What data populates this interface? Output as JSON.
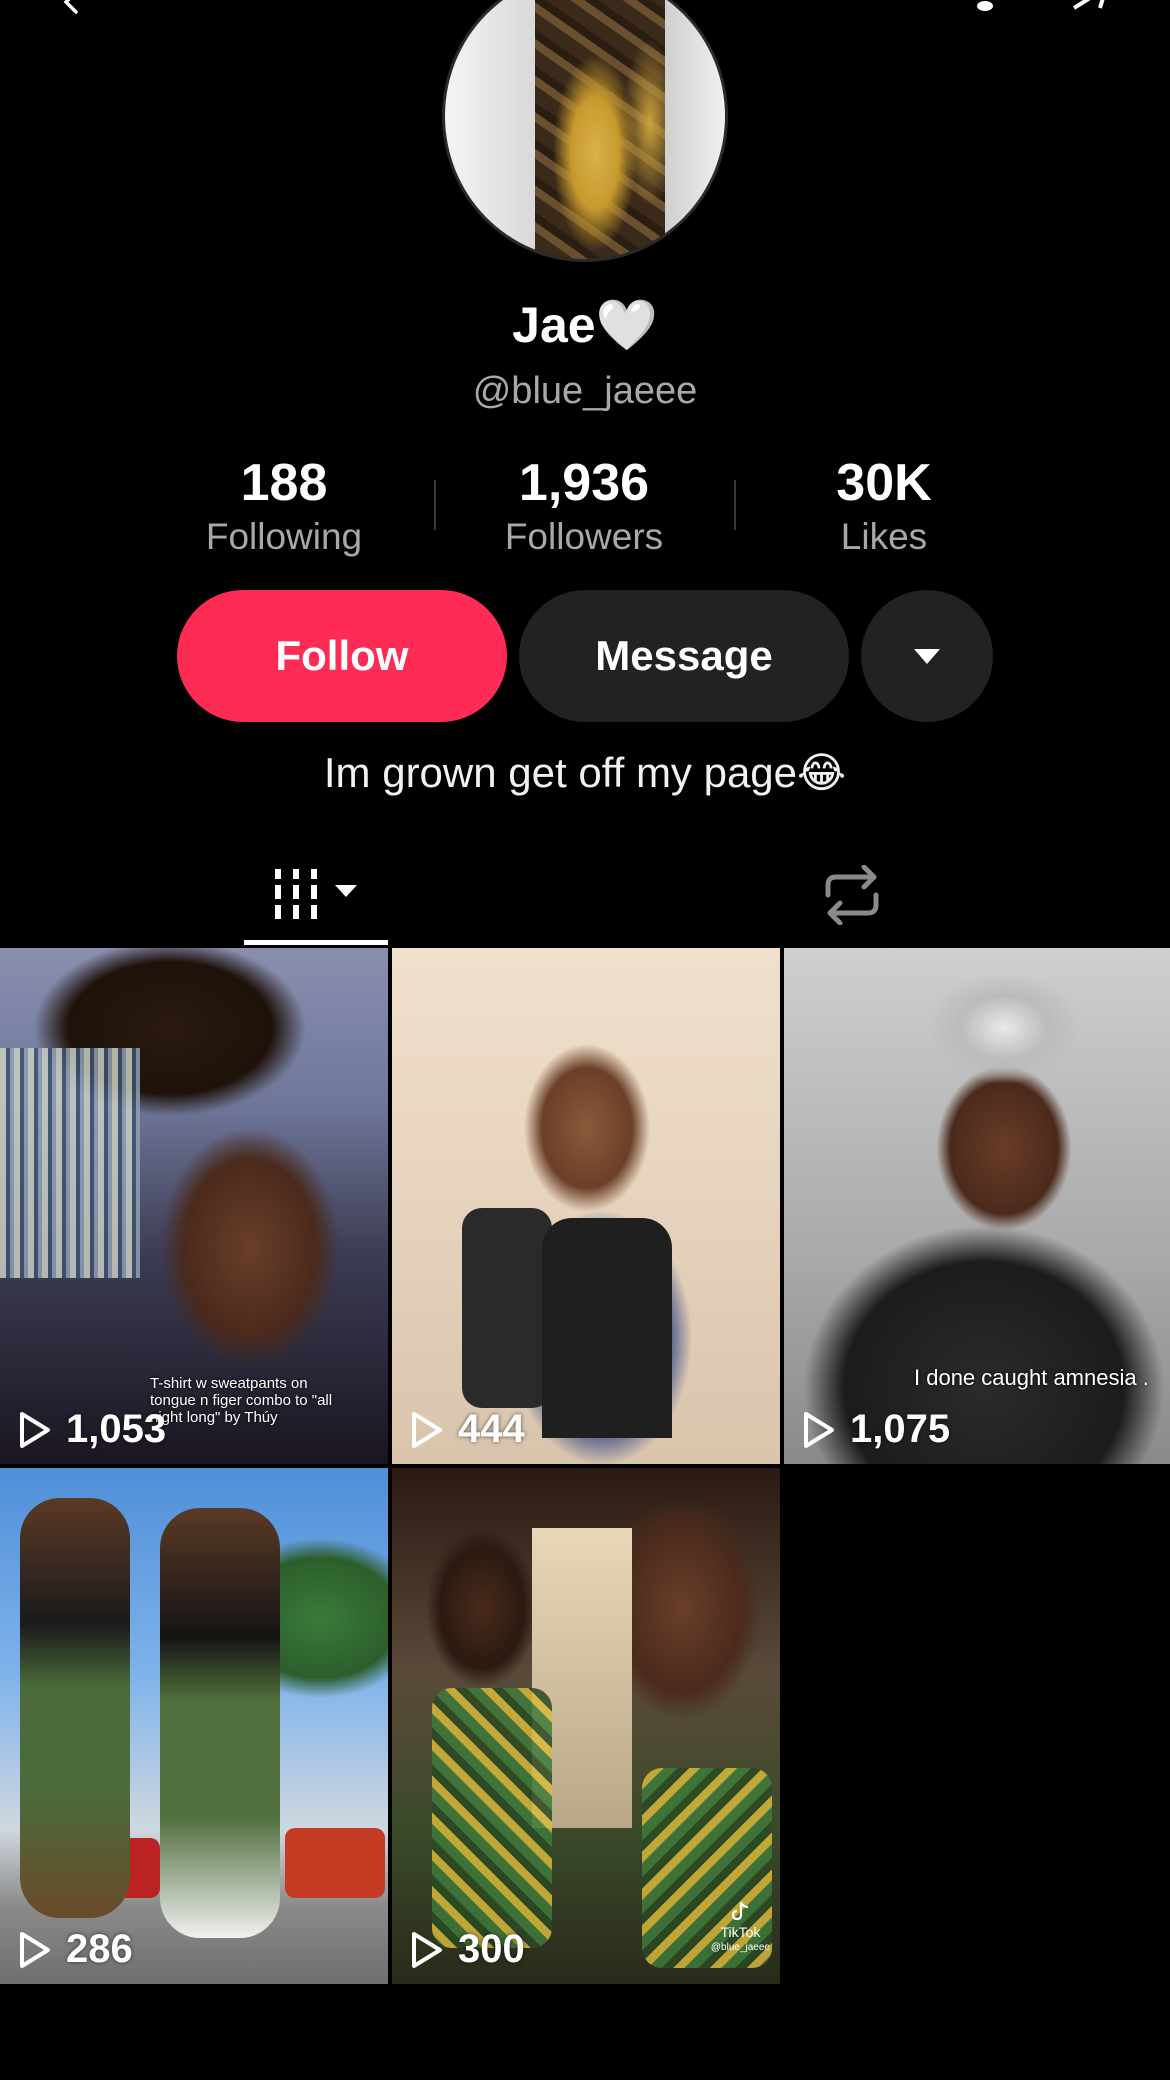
{
  "profile": {
    "name": "Jae🤍",
    "handle": "@blue_jaeee",
    "bio": "Im grown get off my page😂"
  },
  "stats": {
    "following_count": "188",
    "following_label": "Following",
    "followers_count": "1,936",
    "followers_label": "Followers",
    "likes_count": "30K",
    "likes_label": "Likes"
  },
  "actions": {
    "follow_label": "Follow",
    "message_label": "Message"
  },
  "colors": {
    "accent": "#fe2c55",
    "background": "#000000",
    "button_dark": "#222222",
    "secondary_text": "#a8a8a8"
  },
  "tabs": [
    {
      "icon": "videos-grid-icon",
      "active": true
    },
    {
      "icon": "repost-icon",
      "active": false
    }
  ],
  "videos": [
    {
      "views": "1,053",
      "caption": "T-shirt w sweatpants on tongue n figer combo to \"all night long\" by Thúy"
    },
    {
      "views": "444"
    },
    {
      "views": "1,075",
      "caption": "I done caught amnesia ."
    },
    {
      "views": "286"
    },
    {
      "views": "300",
      "watermark_brand": "TikTok",
      "watermark_handle": "@blue_jaeee"
    }
  ]
}
